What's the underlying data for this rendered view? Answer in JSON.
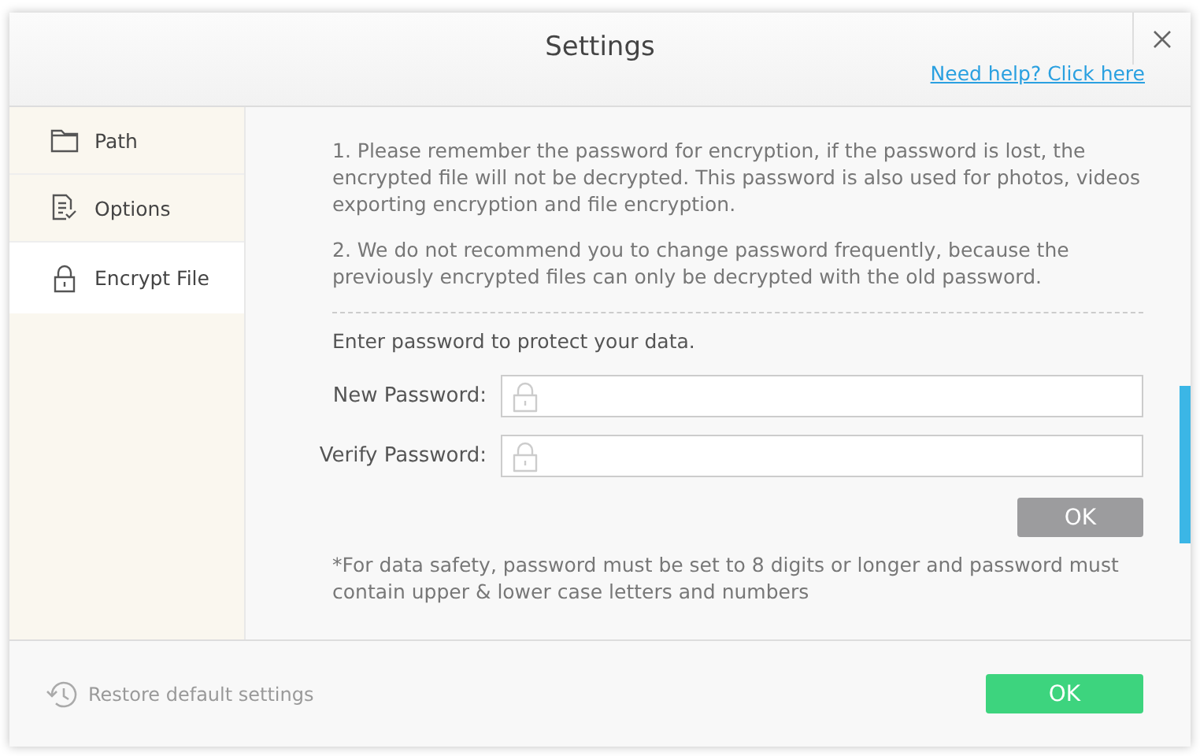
{
  "dialog": {
    "title": "Settings",
    "help_link": "Need help? Click here"
  },
  "sidebar": {
    "items": [
      {
        "label": "Path",
        "kind": "folder",
        "selected": false
      },
      {
        "label": "Options",
        "kind": "document",
        "selected": false
      },
      {
        "label": "Encrypt File",
        "kind": "lock",
        "selected": true
      }
    ]
  },
  "notes": [
    "1. Please remember the password for encryption, if the password is lost, the encrypted file will not be decrypted. This password is also used for photos, videos exporting encryption and file encryption.",
    "2. We do not recommend you to change password frequently, because the previously encrypted files can only be decrypted with the old password."
  ],
  "password_section": {
    "prompt": "Enter password to protect your data.",
    "fields": [
      {
        "label": "New Password:"
      },
      {
        "label": "Verify Password:"
      }
    ],
    "button": {
      "label": "OK",
      "disabled": true
    },
    "hint": "*For data safety, password must be set to 8 digits or longer and password must contain upper & lower case letters and numbers"
  },
  "footer": {
    "restore": "Restore default settings",
    "ok": "OK"
  }
}
